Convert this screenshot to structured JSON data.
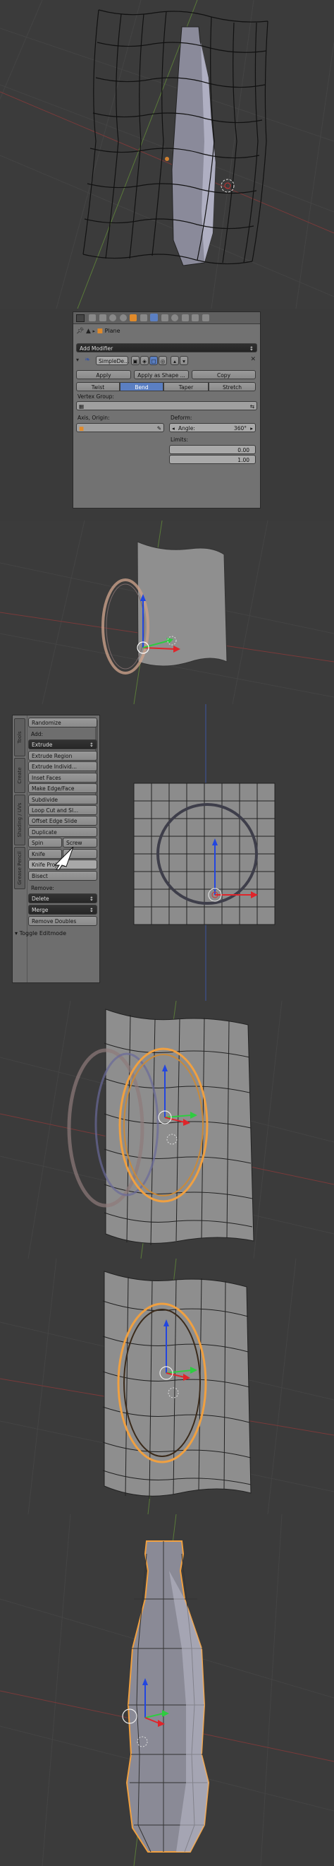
{
  "properties": {
    "object_name": "Plane",
    "add_modifier_label": "Add Modifier",
    "modifier_name": "SimpleDe...",
    "apply_label": "Apply",
    "apply_shape_label": "Apply as Shape ...",
    "copy_label": "Copy",
    "modes": [
      "Twist",
      "Bend",
      "Taper",
      "Stretch"
    ],
    "active_mode": "Bend",
    "vertex_group_label": "Vertex Group:",
    "axis_origin_label": "Axis, Origin:",
    "deform_label": "Deform:",
    "angle_label": "Angle:",
    "angle_value": "360°",
    "limits_label": "Limits:",
    "limit_min": "0.00",
    "limit_max": "1.00"
  },
  "toolshelf": {
    "randomize": "Randomize",
    "add_header": "Add:",
    "extrude_menu": "Extrude",
    "extrude_region": "Extrude Region",
    "extrude_individual": "Extrude Individ...",
    "inset_faces": "Inset Faces",
    "make_edge_face": "Make Edge/Face",
    "subdivide": "Subdivide",
    "loop_cut": "Loop Cut and Sl...",
    "offset_edge": "Offset Edge Slide",
    "duplicate": "Duplicate",
    "spin": "Spin",
    "screw": "Screw",
    "knife": "Knife",
    "knife_project_left": "Knife P",
    "knife_project_right": "roject",
    "bisect": "Bisect",
    "remove_header": "Remove:",
    "delete_menu": "Delete",
    "merge_menu": "Merge",
    "remove_doubles": "Remove Doubles",
    "toggle_editmode": "Toggle Editmode",
    "side_tabs": [
      "Tools",
      "Create",
      "Shading / UVs",
      "Grease Pencil"
    ]
  },
  "colors": {
    "viewport_bg": "#3b3b3b",
    "grid_line": "#474747",
    "x_axis": "#7a3a3a",
    "y_axis": "#5a7a3a",
    "selection_orange": "#f0a040",
    "bend_tab_active": "#5b7fc2",
    "manip_red": "#e0242a",
    "manip_green": "#2ecc40",
    "manip_blue": "#2246e0"
  }
}
